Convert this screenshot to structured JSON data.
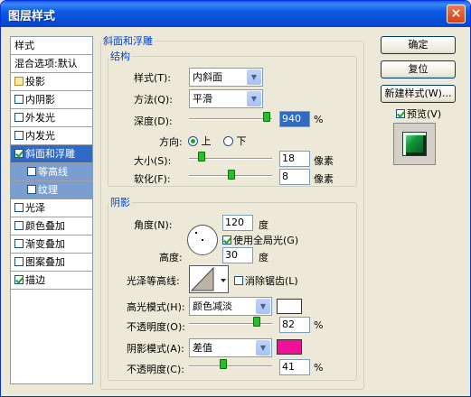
{
  "window": {
    "title": "图层样式",
    "close_glyph": "×"
  },
  "left_panel": {
    "header": "样式",
    "blend_options": "混合选项:默认",
    "items": [
      {
        "label": "投影",
        "checked": false
      },
      {
        "label": "内阴影",
        "checked": false
      },
      {
        "label": "外发光",
        "checked": false
      },
      {
        "label": "内发光",
        "checked": false
      },
      {
        "label": "斜面和浮雕",
        "checked": true
      },
      {
        "label": "等高线",
        "checked": false
      },
      {
        "label": "纹理",
        "checked": false
      },
      {
        "label": "光泽",
        "checked": false
      },
      {
        "label": "颜色叠加",
        "checked": false
      },
      {
        "label": "渐变叠加",
        "checked": false
      },
      {
        "label": "图案叠加",
        "checked": false
      },
      {
        "label": "描边",
        "checked": true
      }
    ]
  },
  "bevel": {
    "group": "斜面和浮雕",
    "structure": {
      "group": "结构",
      "style_label": "样式(T):",
      "style_value": "内斜面",
      "method_label": "方法(Q):",
      "method_value": "平滑",
      "depth_label": "深度(D):",
      "depth_value": "940",
      "depth_unit": "%",
      "direction_label": "方向:",
      "dir_up": "上",
      "dir_down": "下",
      "direction_selected": "上",
      "size_label": "大小(S):",
      "size_value": "18",
      "size_unit": "像素",
      "soften_label": "软化(F):",
      "soften_value": "8",
      "soften_unit": "像素"
    },
    "shading": {
      "group": "阴影",
      "angle_label": "角度(N):",
      "angle_value": "120",
      "angle_unit": "度",
      "global_light_label": "使用全局光(G)",
      "global_light_checked": true,
      "altitude_label": "高度:",
      "altitude_value": "30",
      "altitude_unit": "度",
      "gloss_label": "光泽等高线:",
      "antialias_label": "消除锯齿(L)",
      "antialias_checked": false,
      "highlight_label": "高光模式(H):",
      "highlight_mode": "颜色减淡",
      "highlight_color": "#ffffff",
      "highlight_opacity_label": "不透明度(O):",
      "highlight_opacity": "82",
      "highlight_opacity_unit": "%",
      "shadow_label": "阴影模式(A):",
      "shadow_mode": "差值",
      "shadow_color": "#f0109a",
      "shadow_opacity_label": "不透明度(C):",
      "shadow_opacity": "41",
      "shadow_opacity_unit": "%"
    }
  },
  "right": {
    "ok": "确定",
    "reset": "复位",
    "new_style": "新建样式(W)...",
    "preview": "预览(V)",
    "preview_checked": true
  }
}
